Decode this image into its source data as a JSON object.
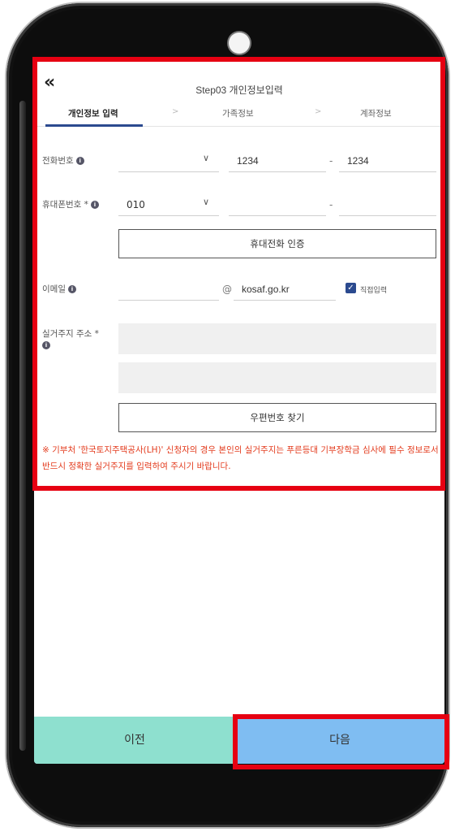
{
  "header": {
    "back_icon": "«",
    "title": "Step03 개인정보입력"
  },
  "steps": {
    "items": [
      {
        "label": "개인정보 입력"
      },
      {
        "label": "가족정보"
      },
      {
        "label": "계좌정보"
      }
    ],
    "separator": ">"
  },
  "form": {
    "phone": {
      "label": "전화번호",
      "area_value": "",
      "middle_value": "1234",
      "last_value": "1234",
      "dash": "-"
    },
    "mobile": {
      "label": "휴대폰번호 *",
      "prefix_value": "010",
      "middle_value": "",
      "last_value": "",
      "dash": "-",
      "verify_button": "휴대전화 인증"
    },
    "email": {
      "label": "이메일",
      "local_value": "",
      "at": "@",
      "domain_value": "kosaf.go.kr",
      "direct_input_label": "직접입력",
      "direct_input_checked": true
    },
    "address": {
      "label": "실거주지 주소 *",
      "line1": "",
      "line2": "",
      "zip_button": "우편번호 찾기"
    },
    "info_icon": "i",
    "chevron_icon": "∨"
  },
  "notice": "※ 기부처 '한국토지주택공사(LH)' 신청자의 경우 본인의 실거주지는 푸른등대 기부장학금 심사에 필수 정보로서 반드시 정확한 실거주지를 입력하여 주시기 바랍니다.",
  "footer": {
    "prev_label": "이전",
    "next_label": "다음"
  },
  "colors": {
    "highlight": "#e60012",
    "prev_button": "#8ee0cf",
    "next_button": "#7fbdf2",
    "notice_text": "#e33b1d",
    "active_step": "#2b4a8f"
  }
}
